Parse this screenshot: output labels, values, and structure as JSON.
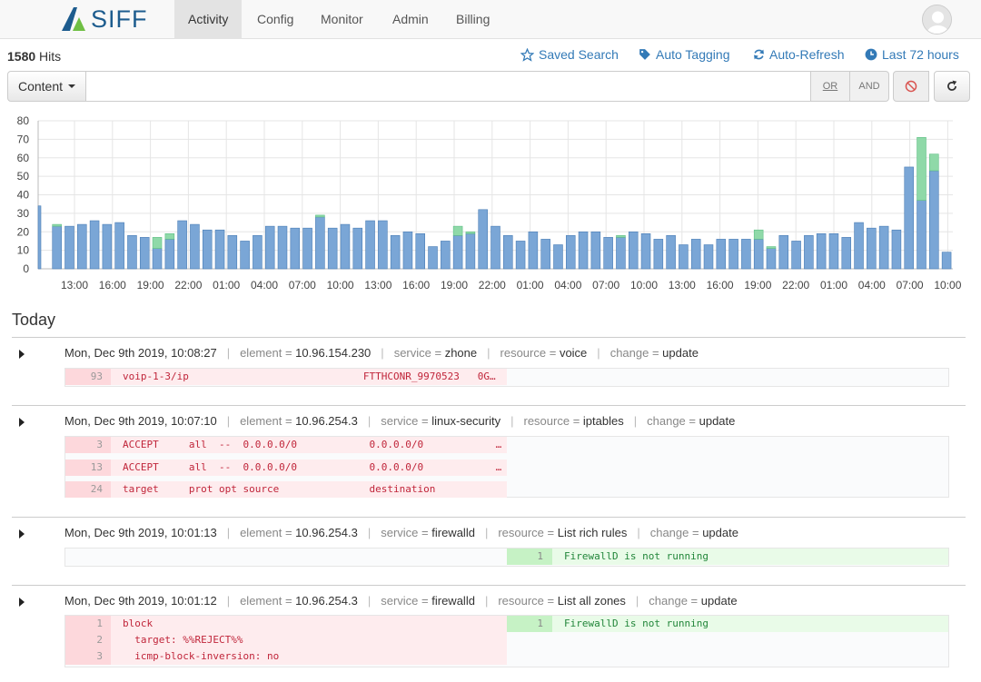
{
  "brand": "SIFF",
  "nav": [
    "Activity",
    "Config",
    "Monitor",
    "Admin",
    "Billing"
  ],
  "hits": {
    "count": "1580",
    "label": "Hits"
  },
  "toolbar": {
    "saved_search": "Saved Search",
    "auto_tagging": "Auto Tagging",
    "auto_refresh": "Auto-Refresh",
    "time_range": "Last 72 hours"
  },
  "search": {
    "field_label": "Content",
    "value": "",
    "or_label": "OR",
    "and_label": "AND"
  },
  "colors": {
    "bar_blue": "#7aa6d6",
    "bar_blue_stroke": "#4a7db5",
    "bar_green": "#8fd9a8",
    "link": "#337ab7"
  },
  "chart_data": {
    "type": "bar",
    "stacked": true,
    "yticks": [
      0,
      10,
      20,
      30,
      40,
      50,
      60,
      70,
      80
    ],
    "ylim": [
      0,
      80
    ],
    "xtick_labels": [
      "13:00",
      "16:00",
      "19:00",
      "22:00",
      "01:00",
      "04:00",
      "07:00",
      "10:00",
      "13:00",
      "16:00",
      "19:00",
      "22:00",
      "01:00",
      "04:00",
      "07:00",
      "10:00",
      "13:00",
      "16:00",
      "19:00",
      "22:00",
      "01:00",
      "04:00",
      "07:00",
      "10:00"
    ],
    "grid": true,
    "series": [
      {
        "values": [
          34,
          23,
          23,
          24,
          26,
          24,
          25,
          18,
          17,
          11,
          16,
          26,
          24,
          21,
          21,
          18,
          15,
          18,
          23,
          23,
          22,
          22,
          28,
          22,
          24,
          22,
          26,
          26,
          18,
          20,
          19,
          12,
          15,
          18,
          19,
          32,
          23,
          18,
          15,
          20,
          16,
          13,
          18,
          20,
          20,
          17,
          17,
          20,
          19,
          16,
          18,
          13,
          16,
          13,
          16,
          16,
          16,
          16,
          11,
          18,
          15,
          18,
          19,
          19,
          17,
          25,
          22,
          23,
          21,
          55,
          37,
          53,
          9
        ]
      },
      {
        "values": [
          0,
          1,
          0,
          0,
          0,
          0,
          0,
          0,
          0,
          6,
          3,
          0,
          0,
          0,
          0,
          0,
          0,
          0,
          0,
          0,
          0,
          0,
          1,
          0,
          0,
          0,
          0,
          0,
          0,
          0,
          0,
          0,
          0,
          5,
          1,
          0,
          0,
          0,
          0,
          0,
          0,
          0,
          0,
          0,
          0,
          0,
          1,
          0,
          0,
          0,
          0,
          0,
          0,
          0,
          0,
          0,
          0,
          5,
          1,
          0,
          0,
          0,
          0,
          0,
          0,
          0,
          0,
          0,
          0,
          0,
          34,
          9,
          0
        ]
      }
    ]
  },
  "section_title": "Today",
  "entries": [
    {
      "timestamp": "Mon, Dec 9th 2019, 10:08:27",
      "element_key": "element =",
      "element": "10.96.154.230",
      "service_key": "service =",
      "service": "zhone",
      "resource_key": "resource =",
      "resource": "voice",
      "change_key": "change =",
      "change": "update",
      "left": [
        {
          "num": "93",
          "code": "voip-1-3/ip                             FTTHCONR_9970523   0G…"
        }
      ],
      "right": []
    },
    {
      "timestamp": "Mon, Dec 9th 2019, 10:07:10",
      "element_key": "element =",
      "element": "10.96.254.3",
      "service_key": "service =",
      "service": "linux-security",
      "resource_key": "resource =",
      "resource": "iptables",
      "change_key": "change =",
      "change": "update",
      "left": [
        {
          "num": "3",
          "code": "ACCEPT     all  --  0.0.0.0/0            0.0.0.0/0            …"
        },
        {
          "num": "13",
          "code": "ACCEPT     all  --  0.0.0.0/0            0.0.0.0/0            …"
        },
        {
          "num": "24",
          "code": "target     prot opt source               destination"
        }
      ],
      "right": []
    },
    {
      "timestamp": "Mon, Dec 9th 2019, 10:01:13",
      "element_key": "element =",
      "element": "10.96.254.3",
      "service_key": "service =",
      "service": "firewalld",
      "resource_key": "resource =",
      "resource": "List rich rules",
      "change_key": "change =",
      "change": "update",
      "left": [],
      "right": [
        {
          "num": "1",
          "code": "FirewallD is not running"
        }
      ]
    },
    {
      "timestamp": "Mon, Dec 9th 2019, 10:01:12",
      "element_key": "element =",
      "element": "10.96.254.3",
      "service_key": "service =",
      "service": "firewalld",
      "resource_key": "resource =",
      "resource": "List all zones",
      "change_key": "change =",
      "change": "update",
      "left": [
        {
          "num": "1",
          "code": "block"
        },
        {
          "num": "2",
          "code": "  target: %%REJECT%%"
        },
        {
          "num": "3",
          "code": "  icmp-block-inversion: no"
        }
      ],
      "right": [
        {
          "num": "1",
          "code": "FirewallD is not running"
        }
      ]
    }
  ]
}
